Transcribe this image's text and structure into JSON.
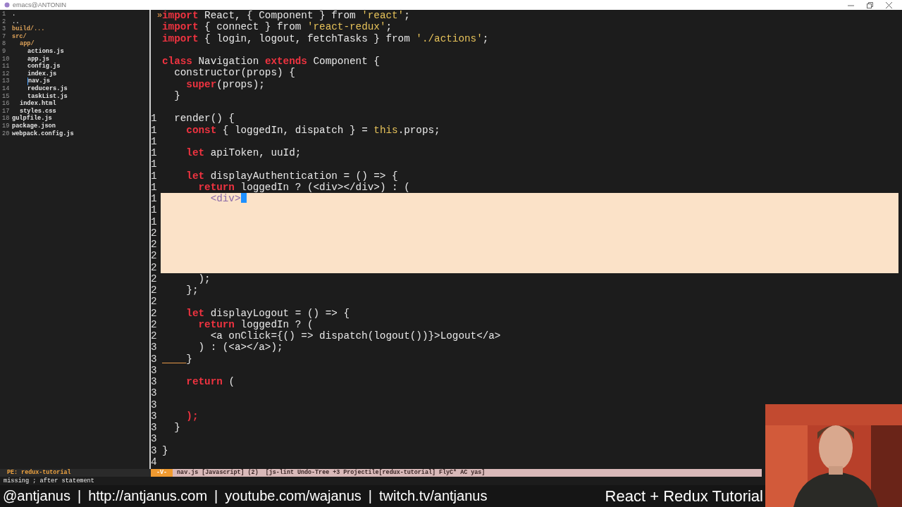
{
  "window": {
    "title": "emacs@ANTONIN"
  },
  "sidebar": {
    "items": [
      {
        "number": "1",
        "name": ".",
        "kind": "file",
        "selected": false
      },
      {
        "number": "2",
        "name": "..",
        "kind": "file",
        "selected": false
      },
      {
        "number": "3",
        "name": "build/...",
        "kind": "dir",
        "selected": false
      },
      {
        "number": "7",
        "name": "src/",
        "kind": "dir",
        "selected": false,
        "children": [
          {
            "number": "8",
            "name": "app/",
            "kind": "dir",
            "selected": false,
            "children": [
              {
                "number": "9",
                "name": "actions.js",
                "kind": "file",
                "selected": false
              },
              {
                "number": "10",
                "name": "app.js",
                "kind": "file",
                "selected": false
              },
              {
                "number": "11",
                "name": "config.js",
                "kind": "file",
                "selected": false
              },
              {
                "number": "12",
                "name": "index.js",
                "kind": "file",
                "selected": false
              },
              {
                "number": "13",
                "name": "nav.js",
                "kind": "file",
                "selected": true
              },
              {
                "number": "14",
                "name": "reducers.js",
                "kind": "file",
                "selected": false
              },
              {
                "number": "15",
                "name": "taskList.js",
                "kind": "file",
                "selected": false
              }
            ]
          },
          {
            "number": "16",
            "name": "index.html",
            "kind": "file",
            "selected": false
          },
          {
            "number": "17",
            "name": "styles.css",
            "kind": "file",
            "selected": false
          }
        ]
      },
      {
        "number": "18",
        "name": "gulpfile.js",
        "kind": "file",
        "selected": false
      },
      {
        "number": "19",
        "name": "package.json",
        "kind": "file",
        "selected": false
      },
      {
        "number": "20",
        "name": "webpack.config.js",
        "kind": "file",
        "selected": false
      }
    ]
  },
  "editor": {
    "lines": [
      {
        "kind": "code",
        "marker": "»",
        "tokens": [
          {
            "kind": "kw",
            "text": "import"
          },
          {
            "kind": "plain",
            "text": " React, { Component } from "
          },
          {
            "kind": "str",
            "text": "'react'"
          },
          {
            "kind": "plain",
            "text": ";"
          }
        ]
      },
      {
        "kind": "code",
        "tokens": [
          {
            "kind": "kw",
            "text": "import"
          },
          {
            "kind": "plain",
            "text": " { connect } from "
          },
          {
            "kind": "str",
            "text": "'react-redux'"
          },
          {
            "kind": "plain",
            "text": ";"
          }
        ]
      },
      {
        "kind": "code",
        "tokens": [
          {
            "kind": "kw",
            "text": "import"
          },
          {
            "kind": "plain",
            "text": " { login, logout, fetchTasks } from "
          },
          {
            "kind": "str",
            "text": "'./actions'"
          },
          {
            "kind": "plain",
            "text": ";"
          }
        ]
      },
      {
        "kind": "code"
      },
      {
        "kind": "code",
        "tokens": [
          {
            "kind": "kw",
            "text": "class"
          },
          {
            "kind": "plain",
            "text": " Navigation "
          },
          {
            "kind": "kw",
            "text": "extends"
          },
          {
            "kind": "plain",
            "text": " Component {"
          }
        ]
      },
      {
        "kind": "code",
        "tokens": [
          {
            "kind": "plain",
            "text": "  constructor(props) {"
          }
        ]
      },
      {
        "kind": "code",
        "tokens": [
          {
            "kind": "kw",
            "text": "    super"
          },
          {
            "kind": "plain",
            "text": "(props);"
          }
        ]
      },
      {
        "kind": "code",
        "tokens": [
          {
            "kind": "plain",
            "text": "  }"
          }
        ]
      },
      {
        "kind": "code"
      },
      {
        "kind": "code",
        "gutter": "1",
        "tokens": [
          {
            "kind": "plain",
            "text": "  render() {"
          }
        ]
      },
      {
        "kind": "code",
        "gutter": "1",
        "tokens": [
          {
            "kind": "kw",
            "text": "    const"
          },
          {
            "kind": "plain",
            "text": " { loggedIn, dispatch } = "
          },
          {
            "kind": "str",
            "text": "this"
          },
          {
            "kind": "plain",
            "text": ".props;"
          }
        ]
      },
      {
        "kind": "code",
        "gutter": "1"
      },
      {
        "kind": "code",
        "gutter": "1",
        "tokens": [
          {
            "kind": "kw",
            "text": "    let"
          },
          {
            "kind": "plain",
            "text": " apiToken, uuId;"
          }
        ]
      },
      {
        "kind": "code",
        "gutter": "1"
      },
      {
        "kind": "code",
        "gutter": "1",
        "tokens": [
          {
            "kind": "kw",
            "text": "    let"
          },
          {
            "kind": "plain",
            "text": " displayAuthentication = () => {"
          }
        ]
      },
      {
        "kind": "code",
        "gutter": "1",
        "tokens": [
          {
            "kind": "kw",
            "text": "      return"
          },
          {
            "kind": "plain",
            "text": " loggedIn ? (<div></div>) : ("
          }
        ]
      },
      {
        "kind": "region-cursor",
        "gutter": "1",
        "tokens": [
          {
            "kind": "faint",
            "text": "        <div>"
          }
        ]
      },
      {
        "kind": "region",
        "gutter": "1"
      },
      {
        "kind": "region",
        "gutter": "1"
      },
      {
        "kind": "region",
        "gutter": "2"
      },
      {
        "kind": "region",
        "gutter": "2"
      },
      {
        "kind": "region",
        "gutter": "2"
      },
      {
        "kind": "region",
        "gutter": "2"
      },
      {
        "kind": "code",
        "gutter": "2",
        "tokens": [
          {
            "kind": "plain",
            "text": "      );"
          }
        ]
      },
      {
        "kind": "code",
        "gutter": "2",
        "tokens": [
          {
            "kind": "plain",
            "text": "    };"
          }
        ]
      },
      {
        "kind": "code",
        "gutter": "2"
      },
      {
        "kind": "code",
        "gutter": "2",
        "tokens": [
          {
            "kind": "kw",
            "text": "    let"
          },
          {
            "kind": "plain",
            "text": " displayLogout = () => {"
          }
        ]
      },
      {
        "kind": "code",
        "gutter": "2",
        "tokens": [
          {
            "kind": "kw",
            "text": "      return"
          },
          {
            "kind": "plain",
            "text": " loggedIn ? ("
          }
        ]
      },
      {
        "kind": "code",
        "gutter": "2",
        "tokens": [
          {
            "kind": "plain",
            "text": "        <a onClick={() => dispatch(logout())}>Logout</a>"
          }
        ]
      },
      {
        "kind": "code",
        "gutter": "3",
        "tokens": [
          {
            "kind": "plain",
            "text": "      ) : (<a></a>);"
          }
        ]
      },
      {
        "kind": "ws-mark",
        "gutter": "3",
        "tokens": [
          {
            "kind": "plain",
            "text": "    }"
          }
        ]
      },
      {
        "kind": "code",
        "gutter": "3"
      },
      {
        "kind": "code",
        "gutter": "3",
        "tokens": [
          {
            "kind": "kw",
            "text": "    return"
          },
          {
            "kind": "plain",
            "text": " ("
          }
        ]
      },
      {
        "kind": "code",
        "gutter": "3"
      },
      {
        "kind": "code",
        "gutter": "3"
      },
      {
        "kind": "code",
        "gutter": "3",
        "tokens": [
          {
            "kind": "kw",
            "text": "    );"
          }
        ]
      },
      {
        "kind": "code",
        "gutter": "3",
        "tokens": [
          {
            "kind": "plain",
            "text": "  }"
          }
        ]
      },
      {
        "kind": "code",
        "gutter": "3"
      },
      {
        "kind": "code",
        "gutter": "3",
        "tokens": [
          {
            "kind": "plain",
            "text": "}"
          }
        ]
      },
      {
        "kind": "code",
        "gutter": "4"
      }
    ]
  },
  "mode_line": {
    "project": "PE: redux-tutorial",
    "state": "-V-",
    "info": "nav.js [Javascript] (2)  [js-lint Undo-Tree +3 Projectile[redux-tutorial] FlyC* AC yas]"
  },
  "echo_area": "missing ; after statement",
  "banner": {
    "links": [
      "@antjanus",
      "http://antjanus.com",
      "youtube.com/wajanus",
      "twitch.tv/antjanus"
    ],
    "separator": "|",
    "title": "React + Redux Tutorial"
  }
}
